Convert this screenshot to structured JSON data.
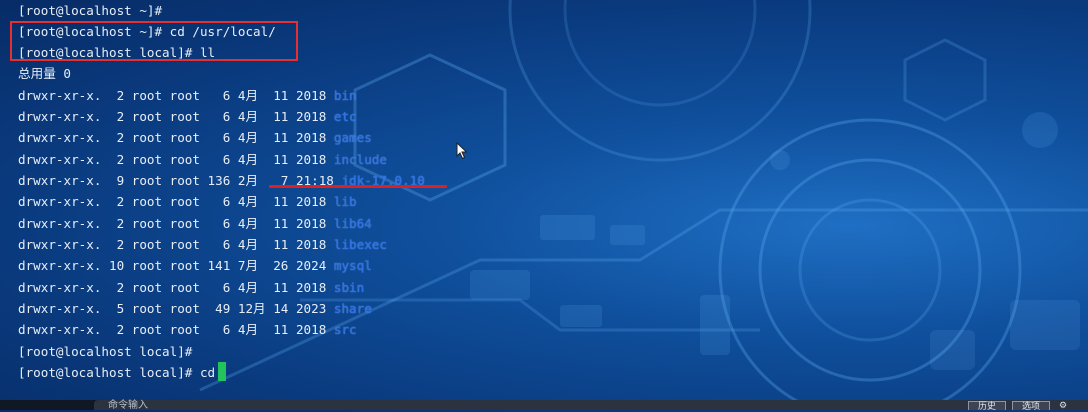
{
  "terminal": {
    "lines": [
      {
        "prefix": "[root@localhost ~]#",
        "name": ""
      },
      {
        "prefix": "[root@localhost ~]# cd /usr/local/",
        "name": ""
      },
      {
        "prefix": "[root@localhost local]# ll",
        "name": ""
      },
      {
        "prefix": "总用量 0",
        "name": ""
      },
      {
        "prefix": "drwxr-xr-x.  2 root root   6 4月  11 2018 ",
        "name": "bin"
      },
      {
        "prefix": "drwxr-xr-x.  2 root root   6 4月  11 2018 ",
        "name": "etc"
      },
      {
        "prefix": "drwxr-xr-x.  2 root root   6 4月  11 2018 ",
        "name": "games"
      },
      {
        "prefix": "drwxr-xr-x.  2 root root   6 4月  11 2018 ",
        "name": "include"
      },
      {
        "prefix": "drwxr-xr-x.  9 root root 136 2月   7 21:18 ",
        "name": "jdk-17.0.10"
      },
      {
        "prefix": "drwxr-xr-x.  2 root root   6 4月  11 2018 ",
        "name": "lib"
      },
      {
        "prefix": "drwxr-xr-x.  2 root root   6 4月  11 2018 ",
        "name": "lib64"
      },
      {
        "prefix": "drwxr-xr-x.  2 root root   6 4月  11 2018 ",
        "name": "libexec"
      },
      {
        "prefix": "drwxr-xr-x. 10 root root 141 7月  26 2024 ",
        "name": "mysql"
      },
      {
        "prefix": "drwxr-xr-x.  2 root root   6 4月  11 2018 ",
        "name": "sbin"
      },
      {
        "prefix": "drwxr-xr-x.  5 root root  49 12月 14 2023 ",
        "name": "share"
      },
      {
        "prefix": "drwxr-xr-x.  2 root root   6 4月  11 2018 ",
        "name": "src"
      },
      {
        "prefix": "[root@localhost local]#",
        "name": ""
      },
      {
        "prefix": "[root@localhost local]# cd",
        "name": ""
      }
    ]
  },
  "bottom": {
    "input_hint": "命令输入",
    "btn_history": "历史",
    "btn_options": "选项"
  },
  "colors": {
    "annotation": "#e5302f",
    "cursor": "#22c35c",
    "directory": "#2d6fe0"
  }
}
